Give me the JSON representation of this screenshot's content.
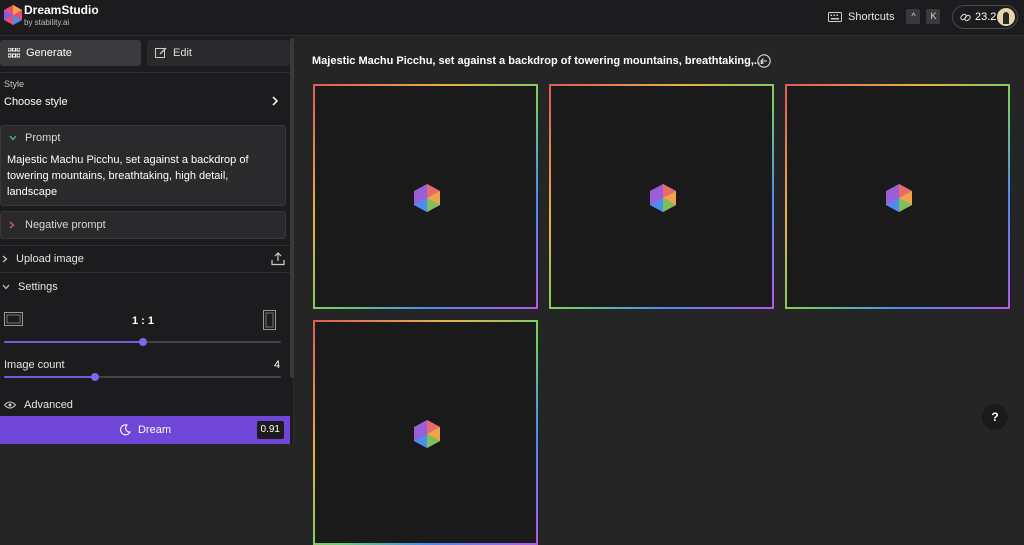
{
  "app": {
    "name": "DreamStudio",
    "subtitle": "by stability.ai"
  },
  "header": {
    "shortcuts_label": "Shortcuts",
    "shortcut_keys": [
      "^",
      "K"
    ],
    "credits": "23.2"
  },
  "sidebar": {
    "tabs": {
      "generate": "Generate",
      "edit": "Edit"
    },
    "style": {
      "label": "Style",
      "value": "Choose style"
    },
    "prompt": {
      "label": "Prompt",
      "text": "Majestic Machu Picchu, set against a backdrop of towering mountains, breathtaking, high detail, landscape"
    },
    "negative_prompt": {
      "label": "Negative prompt"
    },
    "upload_image": {
      "label": "Upload image"
    },
    "settings": {
      "label": "Settings",
      "aspect_ratio": "1 : 1",
      "aspect_ratio_level": 0.5,
      "image_count_label": "Image count",
      "image_count": "4",
      "image_count_level": 0.33
    },
    "advanced": {
      "label": "Advanced"
    },
    "dream": {
      "label": "Dream",
      "cost": "0.91"
    }
  },
  "main": {
    "title": "Majestic Machu Picchu, set against a backdrop of towering mountains, breathtaking,...",
    "images_count": 4
  },
  "help": {
    "label": "?"
  },
  "colors": {
    "accent": "#7046d8",
    "slider": "#6f5ee0",
    "background": "#252525",
    "panel": "#1c1c1e"
  }
}
